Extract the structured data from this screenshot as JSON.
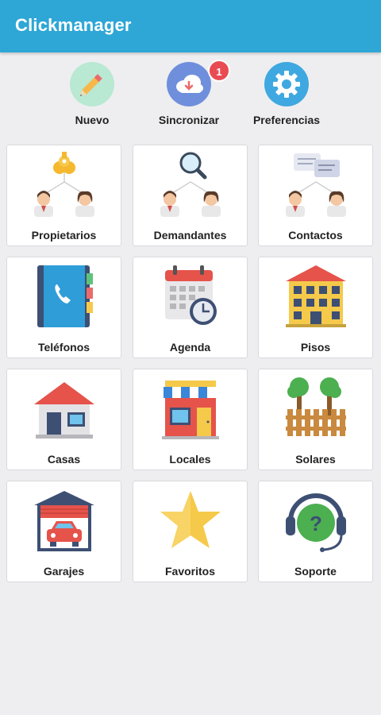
{
  "app": {
    "title": "Clickmanager"
  },
  "quick_actions": [
    {
      "label": "Nuevo",
      "icon": "pencil-icon",
      "color": "#b9e8d3"
    },
    {
      "label": "Sincronizar",
      "icon": "cloud-sync-icon",
      "color": "#6f8fdc",
      "badge": "1"
    },
    {
      "label": "Preferencias",
      "icon": "gear-icon",
      "color": "#3fa8e0"
    }
  ],
  "tiles": [
    {
      "label": "Propietarios",
      "icon": "owners-keys-icon"
    },
    {
      "label": "Demandantes",
      "icon": "seekers-magnifier-icon"
    },
    {
      "label": "Contactos",
      "icon": "contacts-chat-icon"
    },
    {
      "label": "Teléfonos",
      "icon": "phonebook-icon"
    },
    {
      "label": "Agenda",
      "icon": "calendar-clock-icon"
    },
    {
      "label": "Pisos",
      "icon": "apartment-building-icon"
    },
    {
      "label": "Casas",
      "icon": "house-icon"
    },
    {
      "label": "Locales",
      "icon": "shop-icon"
    },
    {
      "label": "Solares",
      "icon": "land-plot-icon"
    },
    {
      "label": "Garajes",
      "icon": "garage-icon"
    },
    {
      "label": "Favoritos",
      "icon": "star-icon"
    },
    {
      "label": "Soporte",
      "icon": "support-headset-icon"
    }
  ],
  "colors": {
    "appbar": "#2ea7d6",
    "background": "#eeeef0",
    "badge": "#e94b53"
  }
}
